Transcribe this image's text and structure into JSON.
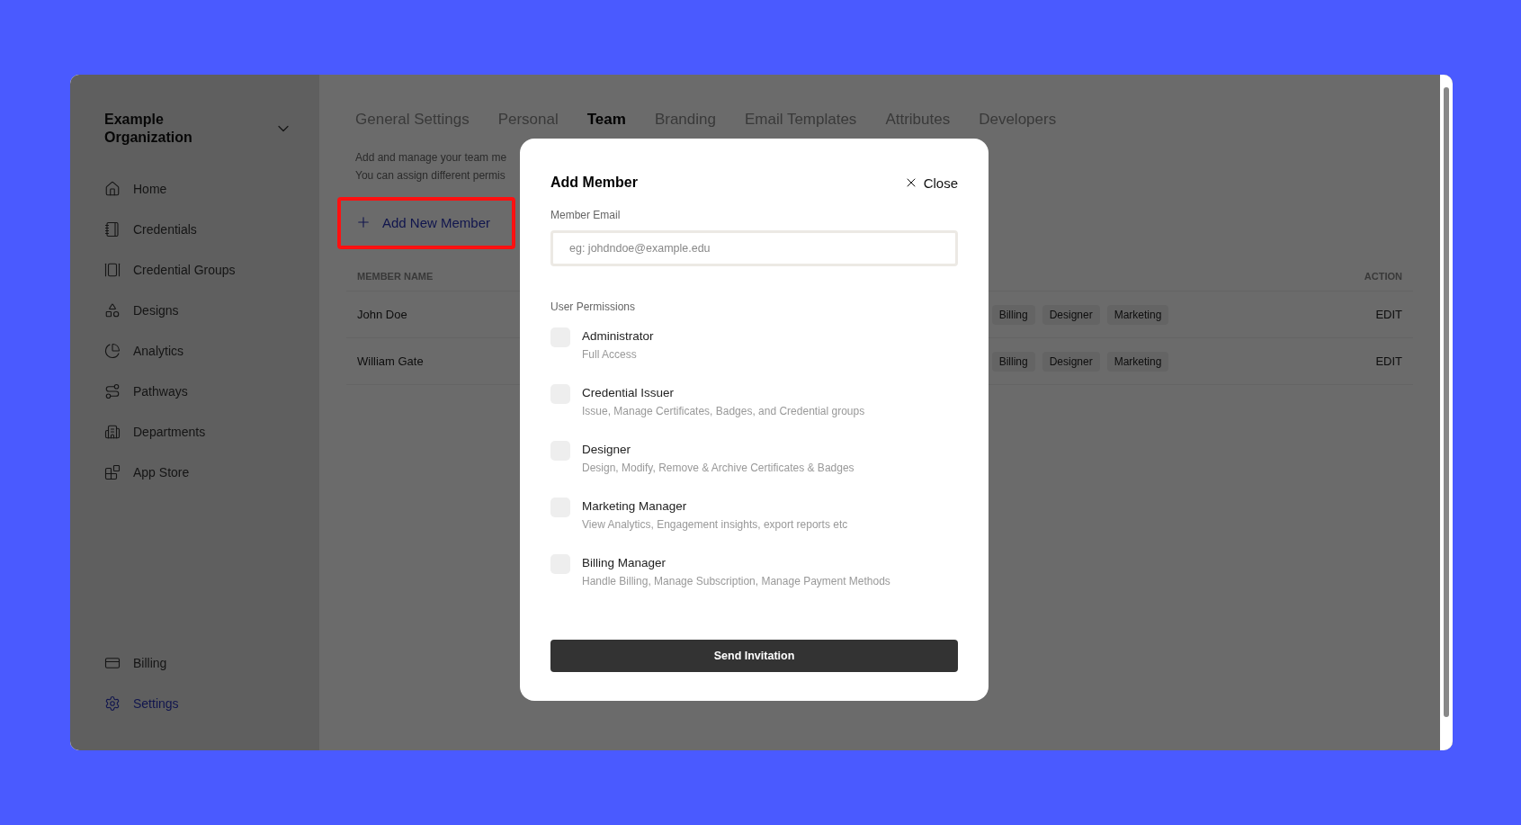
{
  "sidebar": {
    "organization": "Example Organization",
    "items": [
      {
        "label": "Home",
        "selected": false
      },
      {
        "label": "Credentials",
        "selected": false
      },
      {
        "label": "Credential Groups",
        "selected": false
      },
      {
        "label": "Designs",
        "selected": false
      },
      {
        "label": "Analytics",
        "selected": false
      },
      {
        "label": "Pathways",
        "selected": false
      },
      {
        "label": "Departments",
        "selected": false
      },
      {
        "label": "App Store",
        "selected": false
      }
    ],
    "bottom_items": [
      {
        "label": "Billing",
        "selected": false
      },
      {
        "label": "Settings",
        "selected": true
      }
    ]
  },
  "tabs": [
    {
      "label": "General Settings",
      "selected": false
    },
    {
      "label": "Personal",
      "selected": false
    },
    {
      "label": "Team",
      "selected": true
    },
    {
      "label": "Branding",
      "selected": false
    },
    {
      "label": "Email Templates",
      "selected": false
    },
    {
      "label": "Attributes",
      "selected": false
    },
    {
      "label": "Developers",
      "selected": false
    }
  ],
  "description": [
    "Add and manage your team me",
    "You can assign different permis"
  ],
  "add_button": {
    "label": "Add New Member",
    "highlighted": true
  },
  "table": {
    "columns": [
      "MEMBER NAME",
      "ACTION"
    ],
    "rows": [
      {
        "name": "John Doe",
        "roles": [
          "Billing",
          "Designer",
          "Marketing"
        ],
        "action": "EDIT"
      },
      {
        "name": "William Gate",
        "roles": [
          "Billing",
          "Designer",
          "Marketing"
        ],
        "action": "EDIT"
      }
    ]
  },
  "modal": {
    "title": "Add Member",
    "close": "Close",
    "email_label": "Member Email",
    "email_placeholder": "eg: johdndoe@example.edu",
    "permissions_label": "User Permissions",
    "permissions": [
      {
        "name": "Administrator",
        "description": "Full Access",
        "checked": false
      },
      {
        "name": "Credential Issuer",
        "description": "Issue, Manage Certificates, Badges, and Credential groups",
        "checked": false
      },
      {
        "name": "Designer",
        "description": "Design, Modify, Remove & Archive Certificates & Badges",
        "checked": false
      },
      {
        "name": "Marketing Manager",
        "description": "View Analytics, Engagement insights, export reports etc",
        "checked": false
      },
      {
        "name": "Billing Manager",
        "description": "Handle Billing, Manage Subscription, Manage Payment Methods",
        "checked": false
      }
    ],
    "submit": "Send Invitation"
  }
}
